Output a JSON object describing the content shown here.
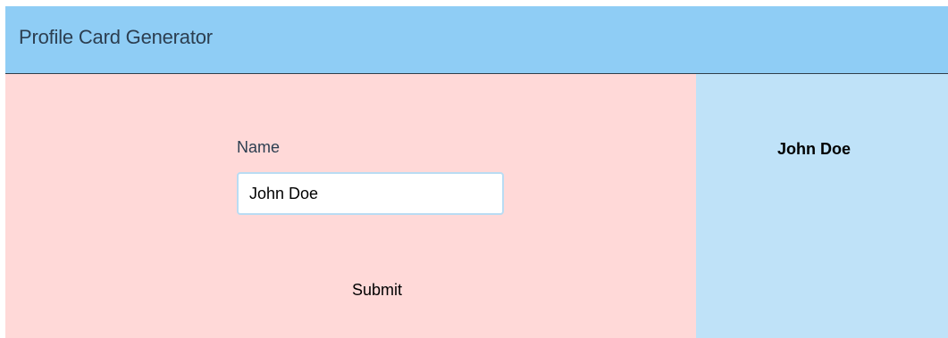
{
  "header": {
    "title": "Profile Card Generator"
  },
  "form": {
    "name_label": "Name",
    "name_value": "John Doe",
    "submit_label": "Submit"
  },
  "card": {
    "name": "John Doe"
  },
  "colors": {
    "header_bg": "#8fcdf5",
    "form_bg": "#ffd9d8",
    "card_bg": "#bfe2f8",
    "input_border": "#b9dcf3",
    "heading_text": "#2c3e50"
  }
}
